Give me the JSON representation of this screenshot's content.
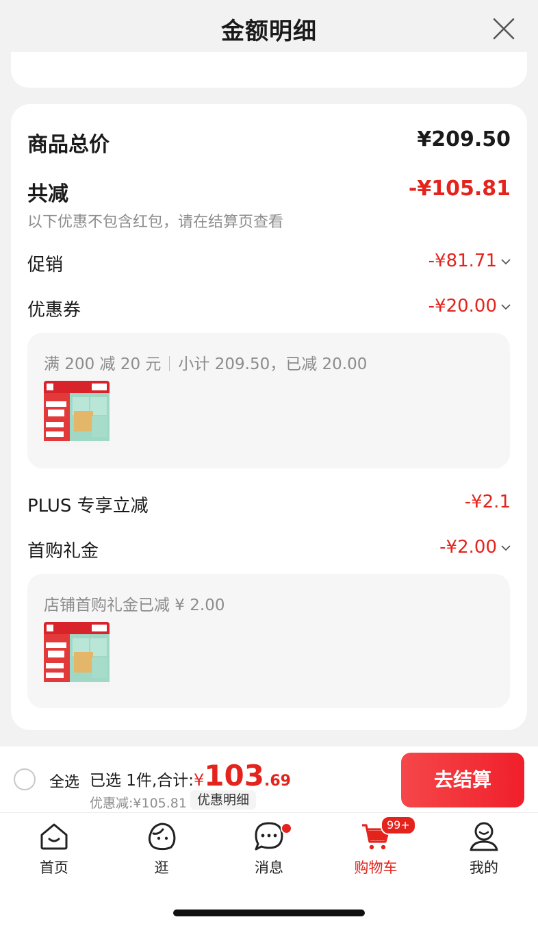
{
  "header": {
    "title": "金额明细"
  },
  "summary": {
    "total_label": "商品总价",
    "total_value": "¥209.50",
    "reduce_label": "共减",
    "reduce_value": "-¥105.81",
    "reduce_note": "以下优惠不包含红包，请在结算页查看"
  },
  "items": {
    "promo": {
      "label": "促销",
      "value": "-¥81.71"
    },
    "coupon": {
      "label": "优惠券",
      "value": "-¥20.00",
      "detail_rule": "满 200 减 20 元",
      "detail_sub": "小计 209.50，已减 20.00"
    },
    "plus": {
      "label": "PLUS 专享立减",
      "value": "-¥2.1"
    },
    "firstbuy": {
      "label": "首购礼金",
      "value": "-¥2.00",
      "detail": "店铺首购礼金已减 ¥ 2.00"
    }
  },
  "bottom": {
    "select_all": "全选",
    "selected_text": "已选 1件,合计:",
    "currency": "¥",
    "total_int": "103",
    "total_dec": ".69",
    "discount_text": "优惠减:¥105.81",
    "detail_link": "优惠明细",
    "checkout": "去结算"
  },
  "tabs": [
    {
      "label": "首页"
    },
    {
      "label": "逛"
    },
    {
      "label": "消息"
    },
    {
      "label": "购物车",
      "badge": "99+"
    },
    {
      "label": "我的"
    }
  ],
  "colors": {
    "accent": "#e4231c",
    "card": "#ffffff",
    "background": "#f2f2f2"
  },
  "icons": [
    "close-icon",
    "chevron-down-icon",
    "home-icon",
    "stroll-icon",
    "message-icon",
    "cart-icon",
    "profile-icon"
  ]
}
